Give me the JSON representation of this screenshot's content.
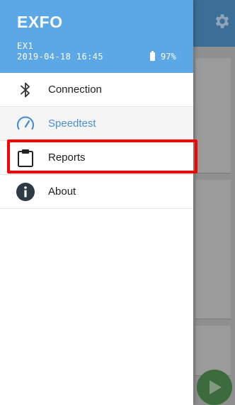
{
  "drawer": {
    "brand": "EXFO",
    "device_name": "EX1",
    "datetime": "2019-04-18 16:45",
    "battery_percent": "97%"
  },
  "menu": {
    "items": [
      {
        "label": "Connection",
        "icon": "bluetooth-icon",
        "active": false
      },
      {
        "label": "Speedtest",
        "icon": "speedometer-icon",
        "active": true
      },
      {
        "label": "Reports",
        "icon": "clipboard-icon",
        "active": false,
        "highlighted": true
      },
      {
        "label": "About",
        "icon": "info-icon",
        "active": false
      }
    ]
  },
  "colors": {
    "header_blue": "#5ca8e6",
    "active_label": "#4a8fcf",
    "highlight_red": "#ff0000",
    "fab_green": "#3c6b3e"
  }
}
